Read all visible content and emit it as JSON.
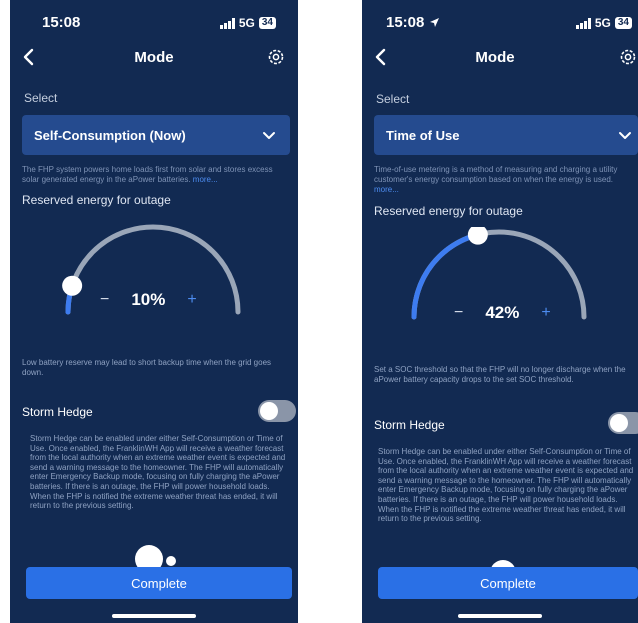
{
  "left": {
    "status": {
      "time": "15:08",
      "network": "5G",
      "battery": "34"
    },
    "nav": {
      "title": "Mode"
    },
    "select_label": "Select",
    "mode_value": "Self-Consumption (Now)",
    "description": "The FHP system powers home loads first from solar and stores excess solar generated energy in the aPower batteries.",
    "more": "more...",
    "reserved_title": "Reserved energy for outage",
    "reserve_level": 0.1,
    "minus": "−",
    "percent": "10%",
    "plus": "+",
    "note": "Low battery reserve may lead to short backup time when the grid goes down.",
    "storm_label": "Storm Hedge",
    "storm_text": "Storm Hedge can be enabled under either Self-Consumption or Time of Use. Once enabled, the FranklinWH App will receive a weather forecast from the local authority when an extreme weather event is expected and send a warning message to the homeowner. The FHP will automatically enter Emergency Backup mode, focusing on fully charging the aPower batteries. If there is an outage, the FHP will power household loads. When the FHP is notified the extreme weather threat has ended, it will return to the previous setting.",
    "complete_label": "Complete"
  },
  "right": {
    "status": {
      "time": "15:08",
      "network": "5G",
      "battery": "34"
    },
    "nav": {
      "title": "Mode"
    },
    "select_label": "Select",
    "mode_value": "Time of Use",
    "description": "Time-of-use metering is a method of measuring and charging a utility customer's energy consumption based on when the energy is used.",
    "more": "more...",
    "reserved_title": "Reserved energy for outage",
    "reserve_level": 0.42,
    "minus": "−",
    "percent": "42%",
    "plus": "+",
    "note": "Set a SOC threshold so that the FHP will no longer discharge when the aPower battery capacity drops to the set SOC threshold.",
    "storm_label": "Storm Hedge",
    "storm_text": "Storm Hedge can be enabled under either Self-Consumption or Time of Use. Once enabled, the FranklinWH App will receive a weather forecast from the local authority when an extreme weather event is expected and send a warning message to the homeowner. The FHP will automatically enter Emergency Backup mode, focusing on fully charging the aPower batteries. If there is an outage, the FHP will power household loads. When the FHP is notified the extreme weather threat has ended, it will return to the previous setting.",
    "complete_label": "Complete"
  },
  "colors": {
    "background": "#122a52",
    "select_fill": "#254b8f",
    "accent": "#2a70e6",
    "gauge_track": "#9aa6b8",
    "gauge_fill": "#3d7cf0"
  },
  "icons": [
    "back-chevron-icon",
    "gear-icon",
    "chevron-down-icon",
    "signal-icon",
    "location-arrow-icon"
  ]
}
